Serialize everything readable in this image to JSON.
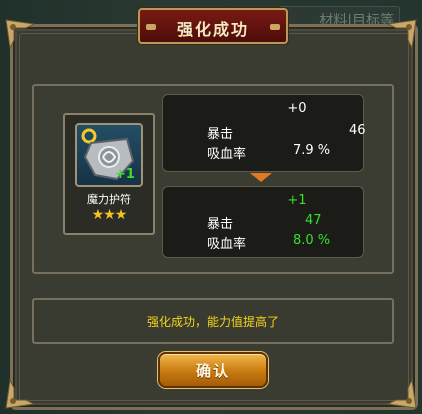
{
  "background": {
    "tab_text": "材料|目标等"
  },
  "dialog": {
    "title": "强化成功"
  },
  "item": {
    "name": "魔力护符",
    "level_badge": "+1",
    "stars": "★★★",
    "star_count": 3,
    "icon": "amulet-icon"
  },
  "stats_before": {
    "plus": "+0",
    "rows": [
      {
        "label": "暴击",
        "value": "46"
      },
      {
        "label": "吸血率",
        "value": "7.9 %"
      }
    ]
  },
  "stats_after": {
    "plus": "+1",
    "rows": [
      {
        "label": "暴击",
        "value": "47"
      },
      {
        "label": "吸血率",
        "value": "8.0 %"
      }
    ]
  },
  "message": "强化成功，能力值提高了",
  "confirm_button": "确认",
  "colors": {
    "gold": "#f6d51b",
    "green": "#38e028",
    "title_red": "#7a1a15",
    "arrow": "#e07920"
  }
}
